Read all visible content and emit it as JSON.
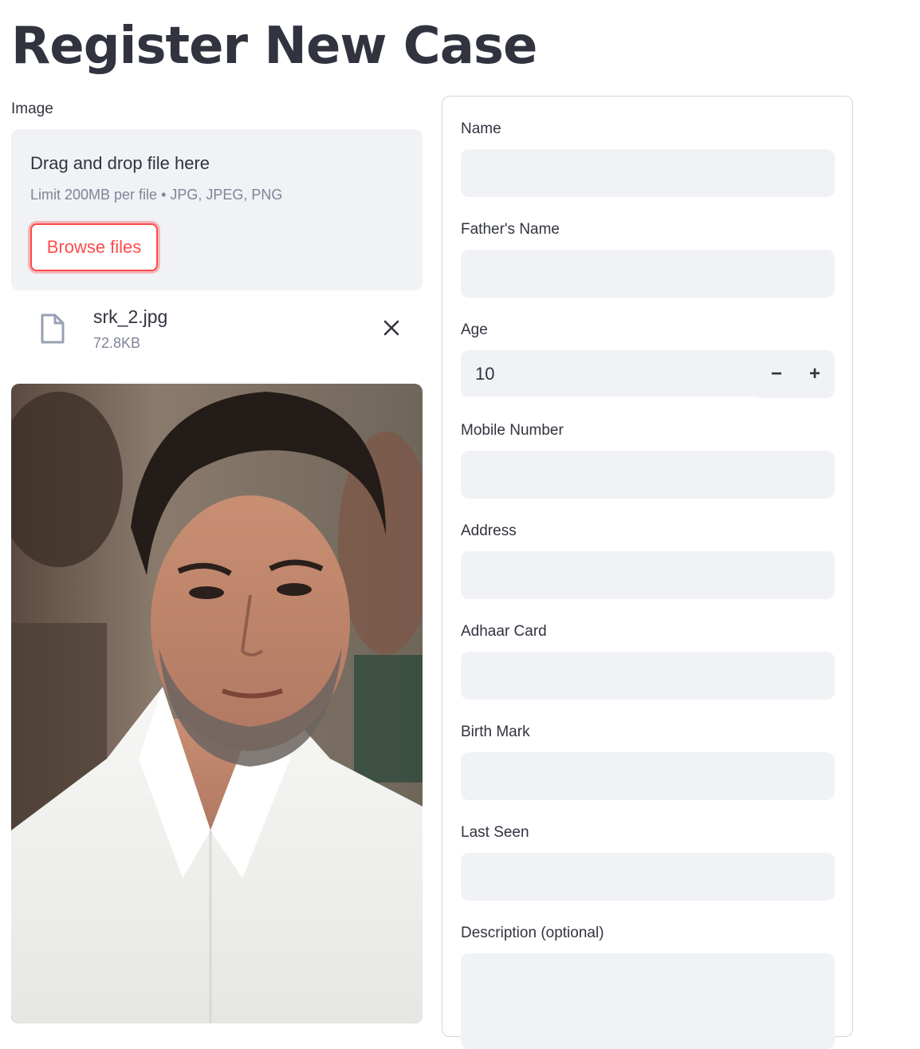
{
  "page": {
    "title": "Register New Case"
  },
  "uploader": {
    "label": "Image",
    "drop_text": "Drag and drop file here",
    "limit_text": "Limit 200MB per file • JPG, JPEG, PNG",
    "browse_label": "Browse files",
    "file": {
      "name": "srk_2.jpg",
      "size": "72.8KB",
      "icon": "file-icon"
    },
    "close_icon": "close-icon"
  },
  "form": {
    "name": {
      "label": "Name",
      "value": ""
    },
    "fathers_name": {
      "label": "Father's Name",
      "value": ""
    },
    "age": {
      "label": "Age",
      "value": "10",
      "minus": "−",
      "plus": "+"
    },
    "mobile": {
      "label": "Mobile Number",
      "value": ""
    },
    "address": {
      "label": "Address",
      "value": ""
    },
    "adhaar": {
      "label": "Adhaar Card",
      "value": ""
    },
    "birth_mark": {
      "label": "Birth Mark",
      "value": ""
    },
    "last_seen": {
      "label": "Last Seen",
      "value": ""
    },
    "description": {
      "label": "Description (optional)",
      "value": ""
    }
  },
  "colors": {
    "accent": "#ff4b4b",
    "input_bg": "#f0f2f6",
    "text": "#31333f",
    "muted": "#808495"
  }
}
